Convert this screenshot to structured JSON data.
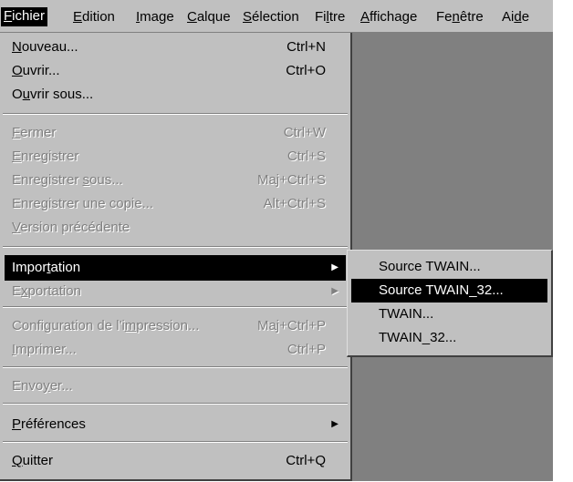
{
  "menubar": {
    "items": [
      {
        "label": "Fichier"
      },
      {
        "label": "Edition"
      },
      {
        "label": "Image"
      },
      {
        "label": "Calque"
      },
      {
        "label": "Sélection"
      },
      {
        "label": "Filtre"
      },
      {
        "label": "Affichage"
      },
      {
        "label": "Fenêtre"
      },
      {
        "label": "Aide"
      }
    ]
  },
  "file_menu": {
    "nouveau": {
      "label": "Nouveau...",
      "shortcut": "Ctrl+N"
    },
    "ouvrir": {
      "label": "Ouvrir...",
      "shortcut": "Ctrl+O"
    },
    "ouvrir_sous": {
      "label": "Ouvrir sous..."
    },
    "fermer": {
      "label": "Fermer",
      "shortcut": "Ctrl+W"
    },
    "enregistrer": {
      "label": "Enregistrer",
      "shortcut": "Ctrl+S"
    },
    "enregistrer_sous": {
      "label": "Enregistrer sous...",
      "shortcut": "Maj+Ctrl+S"
    },
    "enregistrer_copie": {
      "label": "Enregistrer une copie...",
      "shortcut": "Alt+Ctrl+S"
    },
    "version_precedente": {
      "label": "Version précédente"
    },
    "importation": {
      "label": "Importation"
    },
    "exportation": {
      "label": "Exportation"
    },
    "configuration": {
      "label": "Configuration de l'impression...",
      "shortcut": "Maj+Ctrl+P"
    },
    "imprimer": {
      "label": "Imprimer...",
      "shortcut": "Ctrl+P"
    },
    "envoyer": {
      "label": "Envoyer..."
    },
    "preferences": {
      "label": "Préférences"
    },
    "quitter": {
      "label": "Quitter",
      "shortcut": "Ctrl+Q"
    }
  },
  "import_submenu": {
    "items": [
      {
        "label": "Source TWAIN..."
      },
      {
        "label": "Source TWAIN_32..."
      },
      {
        "label": "TWAIN..."
      },
      {
        "label": "TWAIN_32..."
      }
    ]
  }
}
